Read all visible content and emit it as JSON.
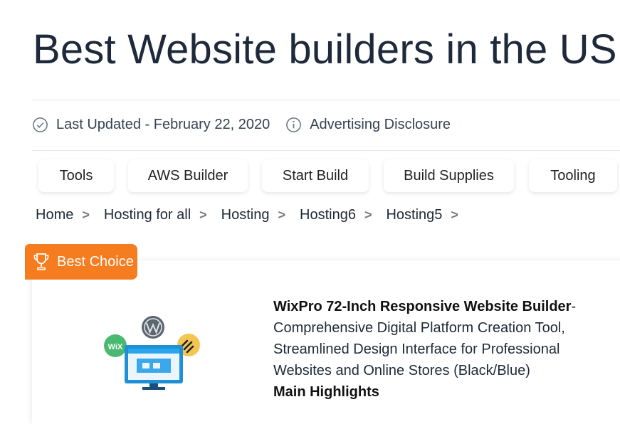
{
  "page": {
    "title": "Best Website builders in the US"
  },
  "meta": {
    "last_updated": "Last Updated - February 22, 2020",
    "disclosure": "Advertising Disclosure"
  },
  "tabs": [
    {
      "label": "Tools"
    },
    {
      "label": "AWS Builder"
    },
    {
      "label": "Start Build"
    },
    {
      "label": "Build Supplies"
    },
    {
      "label": "Tooling"
    }
  ],
  "breadcrumb": [
    {
      "label": "Home",
      "sep": ">"
    },
    {
      "label": "Hosting for all",
      "sep": ">"
    },
    {
      "label": "Hosting",
      "sep": ">"
    },
    {
      "label": "Hosting6",
      "sep": ">"
    },
    {
      "label": "Hosting5",
      "sep": ">"
    }
  ],
  "product": {
    "badge": "Best Choice",
    "name": "WixPro 72-Inch Responsive Website Builder",
    "name_suffix": "-",
    "description": "Comprehensive Digital Platform Creation Tool, Streamlined Design Interface for Professional Websites and Online Stores (Black/Blue)",
    "highlights_label": "Main Highlights",
    "image_logos": {
      "wix": "WiX"
    }
  },
  "colors": {
    "badge": "#f57c1f",
    "title": "#1e2a3b",
    "monitor": "#1f8fd6"
  }
}
